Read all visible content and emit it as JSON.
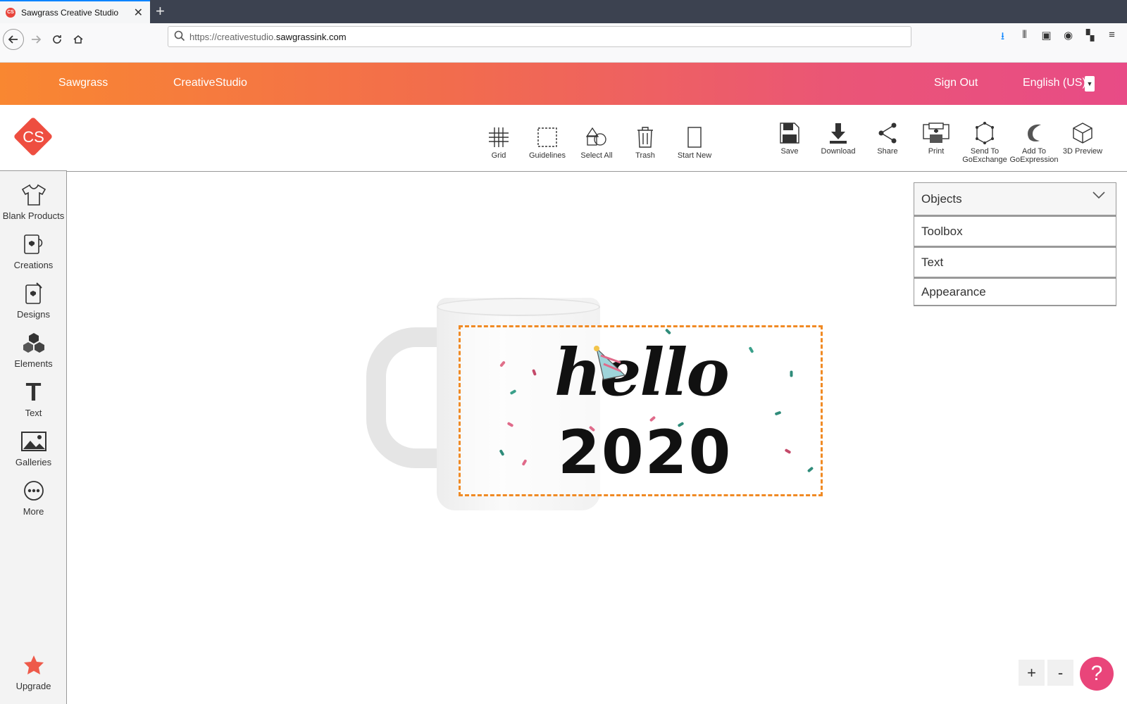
{
  "browser": {
    "tab_title": "Sawgrass Creative Studio",
    "tab_favicon": "CS",
    "new_tab": "+",
    "close_tab": "✕",
    "url_prefix": "https://creativestudio.",
    "url_host": "sawgrassink.com"
  },
  "header": {
    "brand1": "Sawgrass",
    "brand2": "CreativeStudio",
    "sign_out": "Sign Out",
    "language": "English (US)",
    "colors": {
      "gradient_start": "#f98731",
      "gradient_end": "#e84b86"
    }
  },
  "sidebar": {
    "logo": "CS",
    "items": [
      {
        "label": "Blank Products",
        "icon": "tshirt-icon"
      },
      {
        "label": "Creations",
        "icon": "mug-icon"
      },
      {
        "label": "Designs",
        "icon": "design-icon"
      },
      {
        "label": "Elements",
        "icon": "cubes-icon"
      },
      {
        "label": "Text",
        "icon": "text-icon"
      },
      {
        "label": "Galleries",
        "icon": "image-icon"
      },
      {
        "label": "More",
        "icon": "more-icon"
      }
    ],
    "upgrade": "Upgrade"
  },
  "toolbar": {
    "grid": "Grid",
    "guidelines": "Guidelines",
    "select_all": "Select All",
    "trash": "Trash",
    "start_new": "Start New",
    "save": "Save",
    "download": "Download",
    "share": "Share",
    "print": "Print",
    "send_to_1": "Send To",
    "send_to_2": "GoExchange",
    "add_to_1": "Add To",
    "add_to_2": "GoExpression",
    "preview": "3D Preview"
  },
  "canvas": {
    "design_line1": "hello",
    "design_line2": "2020",
    "selection_color": "#f08a24"
  },
  "panel": {
    "objects": "Objects",
    "toolbox": "Toolbox",
    "text": "Text",
    "appearance": "Appearance"
  },
  "zoom": {
    "plus": "+",
    "minus": "-"
  },
  "help": "?"
}
